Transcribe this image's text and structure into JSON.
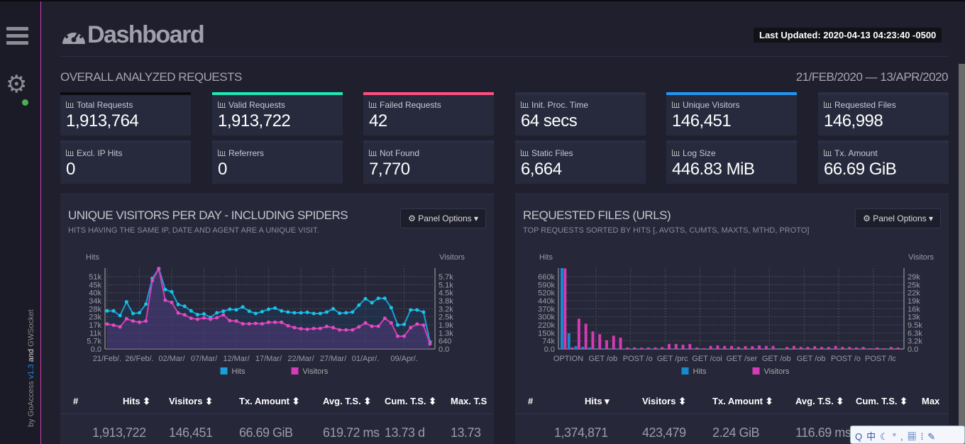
{
  "sidebar": {
    "credit_by": "by GoAccess",
    "credit_version": "v1.3",
    "credit_and": "and",
    "credit_gw": "GWSocket"
  },
  "header": {
    "title": "Dashboard",
    "last_updated": "Last Updated: 2020-04-13 04:23:40 -0500"
  },
  "overview": {
    "section_title": "OVERALL ANALYZED REQUESTS",
    "date_range": "21/FEB/2020 — 13/APR/2020",
    "cards": [
      {
        "label": "Total Requests",
        "value": "1,913,764",
        "accent": "#0b0b0f"
      },
      {
        "label": "Valid Requests",
        "value": "1,913,722",
        "accent": "#1de9b6"
      },
      {
        "label": "Failed Requests",
        "value": "42",
        "accent": "#ff4f81"
      },
      {
        "label": "Init. Proc. Time",
        "value": "64 secs",
        "accent": ""
      },
      {
        "label": "Unique Visitors",
        "value": "146,451",
        "accent": "#2196f3"
      },
      {
        "label": "Requested Files",
        "value": "146,998",
        "accent": ""
      },
      {
        "label": "Excl. IP Hits",
        "value": "0",
        "accent": ""
      },
      {
        "label": "Referrers",
        "value": "0",
        "accent": ""
      },
      {
        "label": "Not Found",
        "value": "7,770",
        "accent": ""
      },
      {
        "label": "Static Files",
        "value": "6,664",
        "accent": ""
      },
      {
        "label": "Log Size",
        "value": "446.83 MiB",
        "accent": ""
      },
      {
        "label": "Tx. Amount",
        "value": "66.69 GiB",
        "accent": ""
      }
    ]
  },
  "panels": [
    {
      "title": "UNIQUE VISITORS PER DAY - INCLUDING SPIDERS",
      "subtitle": "HITS HAVING THE SAME IP, DATE AND AGENT ARE A UNIQUE VISIT.",
      "options": "Panel Options",
      "columns": [
        "#",
        "Hits",
        "Visitors",
        "Tx. Amount",
        "Avg. T.S.",
        "Cum. T.S.",
        "Max. T.S"
      ],
      "totals": [
        "1,913,722",
        "146,451",
        "66.69 GiB",
        "619.72 ms",
        "13.73 d",
        "13.73"
      ]
    },
    {
      "title": "REQUESTED FILES (URLS)",
      "subtitle": "TOP REQUESTS SORTED BY HITS [, AVGTS, CUMTS, MAXTS, MTHD, PROTO]",
      "options": "Panel Options",
      "columns": [
        "#",
        "Hits",
        "Visitors",
        "Tx. Amount",
        "Avg. T.S.",
        "Cum. T.S.",
        "Max"
      ],
      "totals": [
        "1,374,871",
        "423,479",
        "2.24 GiB",
        "116.69 ms"
      ]
    }
  ],
  "chart_data": [
    {
      "type": "line",
      "ylabel": "Hits",
      "y2label": "Visitors",
      "ylim": [
        0,
        57000
      ],
      "y2lim": [
        0,
        6400
      ],
      "grid": true,
      "legend": "bottom",
      "x_ticks": [
        "21/Feb/.",
        "26/Feb/.",
        "02/Mar/",
        "07/Mar/",
        "12/Mar/",
        "17/Mar/",
        "22/Mar/",
        "27/Mar/",
        "01/Apr/.",
        "09/Apr/."
      ],
      "y_ticks": [
        "0.0",
        "5.7k",
        "11k",
        "17k",
        "23k",
        "28k",
        "34k",
        "40k",
        "45k",
        "51k"
      ],
      "y2_ticks": [
        "0.0",
        "640",
        "1.3k",
        "1.9k",
        "2.5k",
        "3.2k",
        "3.8k",
        "4.5k",
        "5.1k",
        "5.7k"
      ],
      "series": [
        {
          "name": "Hits",
          "color": "#1a9fd8",
          "axis": "left",
          "values": [
            26800,
            26800,
            23500,
            33200,
            25000,
            25500,
            31600,
            49700,
            56700,
            41900,
            40300,
            31300,
            30100,
            26800,
            24200,
            24700,
            22200,
            25500,
            26600,
            28000,
            27600,
            29600,
            26600,
            25000,
            26300,
            28000,
            28800,
            26800,
            26000,
            25500,
            25500,
            25800,
            25000,
            25000,
            26000,
            28300,
            25200,
            25500,
            26000,
            30900,
            35400,
            32600,
            35700,
            35700,
            29100,
            16900,
            17300,
            27500,
            27500,
            26000,
            4900
          ]
        },
        {
          "name": "Visitors",
          "color": "#d63bb5",
          "axis": "right",
          "values": [
            1970,
            1880,
            1750,
            2390,
            2210,
            2110,
            2210,
            5420,
            6340,
            3860,
            3680,
            2850,
            2700,
            2430,
            2350,
            2460,
            2350,
            2480,
            2700,
            2240,
            2210,
            1990,
            1990,
            2020,
            1990,
            2110,
            2110,
            2110,
            1840,
            1690,
            1600,
            1560,
            1620,
            1620,
            1780,
            1690,
            1510,
            1510,
            1510,
            1750,
            2060,
            1800,
            1800,
            2430,
            2060,
            1010,
            1010,
            1690,
            1970,
            1880,
            400
          ]
        }
      ]
    },
    {
      "type": "bar",
      "ylabel": "Hits",
      "y2label": "Visitors",
      "ylim": [
        0,
        734000
      ],
      "y2lim": [
        0,
        32300
      ],
      "grid": true,
      "legend": "bottom",
      "x_ticks": [
        "OPTION",
        "GET /ob",
        "POST /o",
        "GET /prc",
        "GET /coi",
        "GET /ser",
        "GET /ob",
        "GET /ob",
        "POST /o",
        "POST /lc"
      ],
      "y_ticks": [
        "0.0",
        "74k",
        "150k",
        "220k",
        "300k",
        "370k",
        "440k",
        "520k",
        "590k",
        "660k"
      ],
      "y2_ticks": [
        "0.0",
        "3.2k",
        "6.3k",
        "9.5k",
        "13k",
        "16k",
        "19k",
        "22k",
        "25k",
        "29k"
      ],
      "series": [
        {
          "name": "Hits",
          "color": "#1a88d0",
          "axis": "left",
          "values": [
            734000,
            143000,
            26000,
            19000,
            13000,
            6000,
            5000,
            5000,
            4000,
            4000,
            3000,
            3000,
            3000,
            3000,
            3000,
            2500,
            2500,
            2500,
            2500,
            2500,
            2000,
            2000,
            2000,
            2000,
            2000,
            2000,
            2000,
            2000,
            2000,
            2000,
            1500,
            1500,
            1500,
            1500,
            1500,
            1500,
            1500,
            1500,
            1500,
            1500,
            1500,
            1500,
            1500,
            1500,
            1500,
            1500,
            1500,
            1500
          ]
        },
        {
          "name": "Visitors",
          "color": "#d63bb5",
          "axis": "right",
          "values": [
            32200,
            600,
            12100,
            10100,
            7000,
            5900,
            3500,
            5300,
            4500,
            600,
            600,
            500,
            600,
            600,
            700,
            2000,
            2000,
            1700,
            2000,
            600,
            300,
            1200,
            1400,
            1200,
            1200,
            800,
            1100,
            1100,
            1400,
            1200,
            1200,
            0,
            800,
            1200,
            800,
            800,
            1100,
            800,
            800,
            1200,
            800,
            800,
            600,
            800,
            300,
            600,
            300,
            800,
            600
          ]
        }
      ]
    }
  ]
}
